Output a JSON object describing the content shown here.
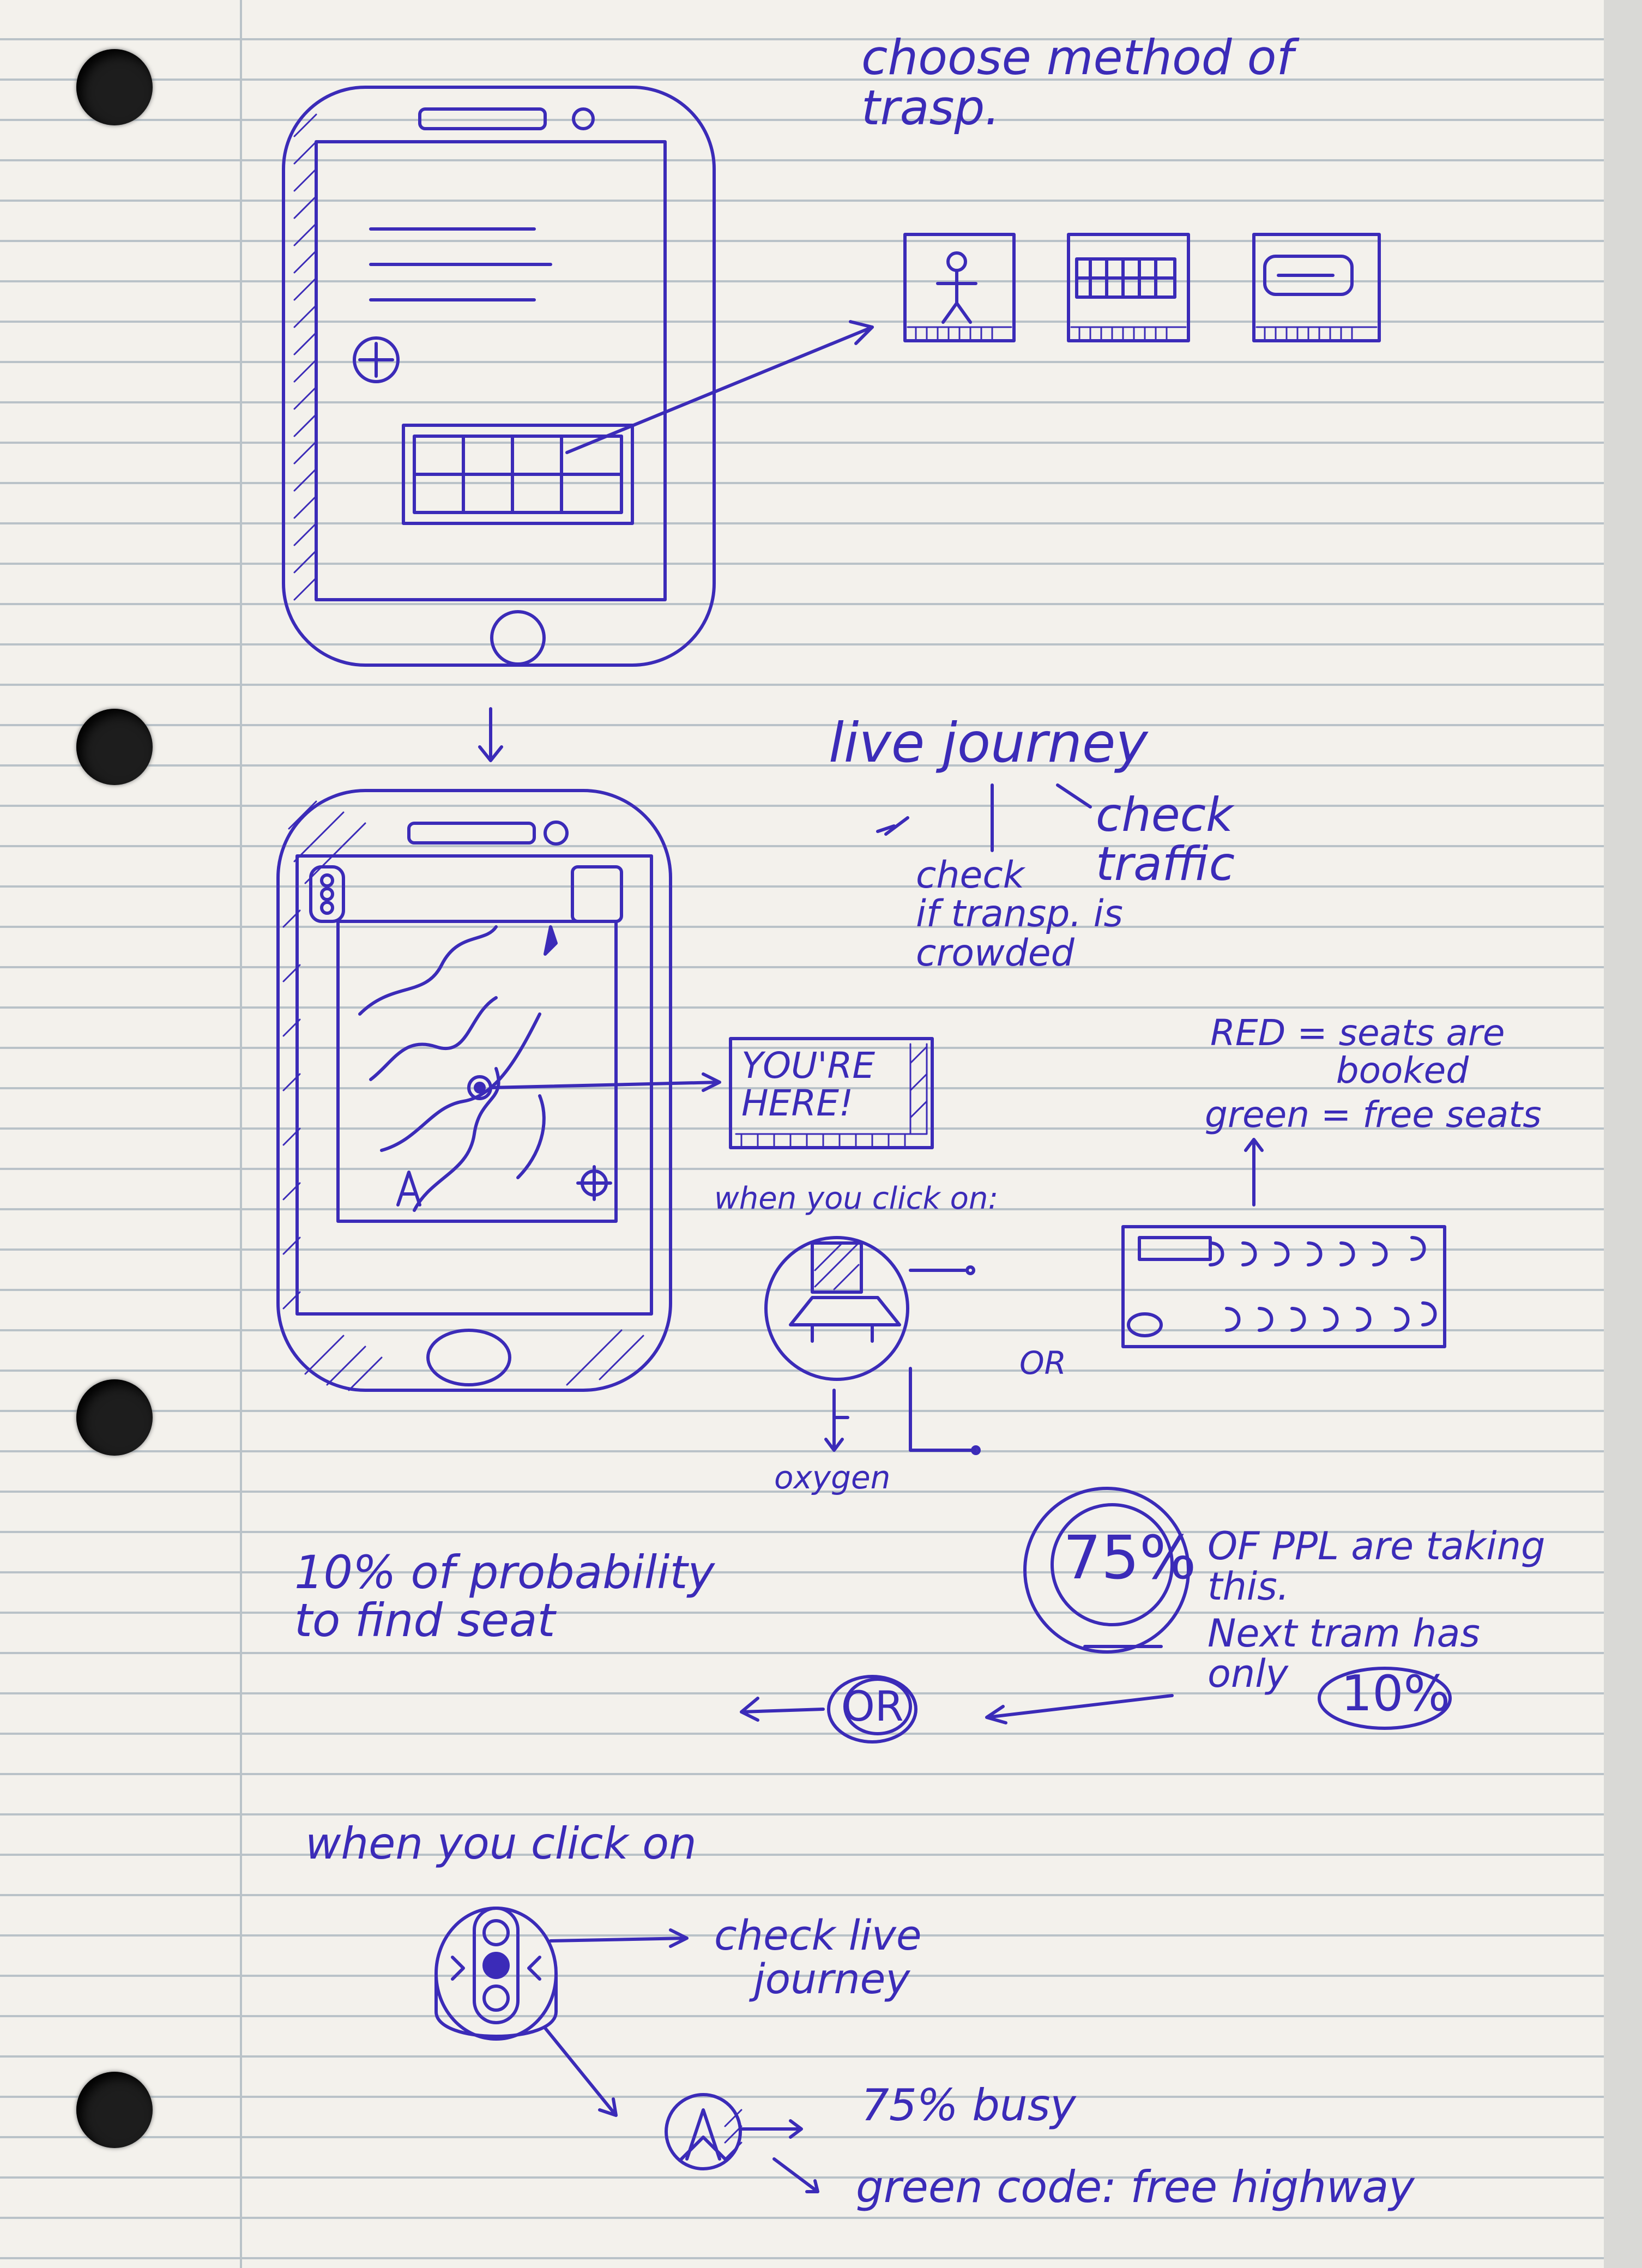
{
  "notes": {
    "choose_method": "choose method of\ntrasp.",
    "live_journey": "live journey",
    "check_traffic": "check\ntraffic",
    "check_crowded": "check\nif transp. is\ncrowded",
    "youre_here": "YOU'RE\nHERE!",
    "red_legend": "RED = seats are\n           booked",
    "green_legend": "green = free seats",
    "when_click_on_1": "when you click on:",
    "or_1": "OR",
    "oxygen": "oxygen",
    "percent_75": "75%",
    "ppl_taking": "OF PPL are taking\nthis.",
    "next_tram": "Next tram has\nonly",
    "percent_10": "10%",
    "probability": "10% of probability\nto find seat",
    "or_2": "OR",
    "when_click_on_2": "when you click on",
    "check_live_journey": "check live\n   journey",
    "busy": "75% busy",
    "green_code": "green code: free highway"
  }
}
